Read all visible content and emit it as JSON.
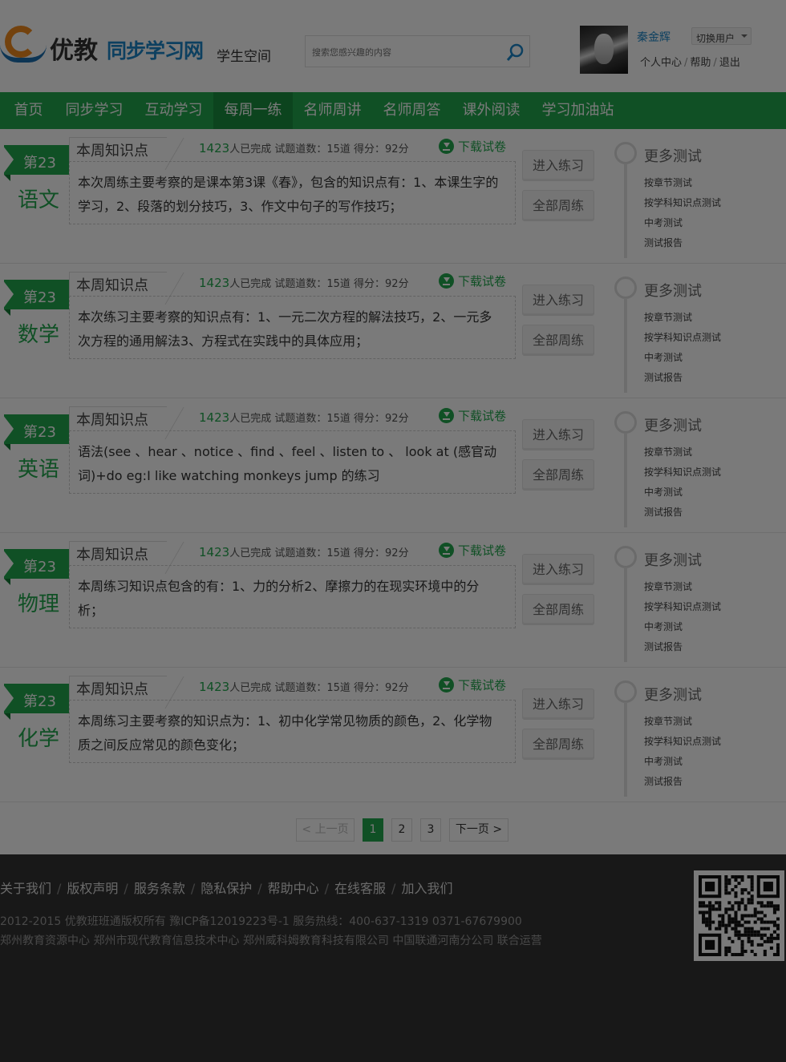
{
  "header": {
    "logo_text_1": "优教",
    "logo_text_2": "同步学习网",
    "space_label": "学生空间",
    "search_placeholder": "搜索您感兴趣的内容",
    "user_name": "秦金辉",
    "switch_user": "切换用户",
    "personal_center": "个人中心",
    "help": "帮助",
    "logout": "退出",
    "sep": "/"
  },
  "nav": {
    "items": [
      "首页",
      "同步学习",
      "互动学习",
      "每周一练",
      "名师周讲",
      "名师周答",
      "课外阅读",
      "学习加油站"
    ],
    "active": "每周一练"
  },
  "rows": [
    {
      "week": "第23",
      "subject": "语文",
      "tab_title": "本周知识点",
      "completed": "1423",
      "completed_suffix": "人已完成",
      "question_count": "试题道数：15道",
      "score": "得分：92分",
      "download": "下载试卷",
      "desc": "本次周练主要考察的是课本第3课《春》，包含的知识点有：1、本课生字的学习，2、段落的划分技巧，3、作文中句子的写作技巧；",
      "enter": "进入练习",
      "all": "全部周练",
      "more_title": "更多测试",
      "more_links": [
        "按章节测试",
        "按学科知识点测试",
        "中考测试",
        "测试报告"
      ]
    },
    {
      "week": "第23",
      "subject": "数学",
      "tab_title": "本周知识点",
      "completed": "1423",
      "completed_suffix": "人已完成",
      "question_count": "试题道数：15道",
      "score": "得分：92分",
      "download": "下载试卷",
      "desc": "本次练习主要考察的知识点有：1、一元二次方程的解法技巧，2、一元多次方程的通用解法3、方程式在实践中的具体应用；",
      "enter": "进入练习",
      "all": "全部周练",
      "more_title": "更多测试",
      "more_links": [
        "按章节测试",
        "按学科知识点测试",
        "中考测试",
        "测试报告"
      ]
    },
    {
      "week": "第23",
      "subject": "英语",
      "tab_title": "本周知识点",
      "completed": "1423",
      "completed_suffix": "人已完成",
      "question_count": "试题道数：15道",
      "score": "得分：92分",
      "download": "下载试卷",
      "desc": "语法(see 、hear 、notice 、find 、feel 、listen to 、 look at (感官动词)+do eg:I like watching monkeys jump 的练习",
      "enter": "进入练习",
      "all": "全部周练",
      "more_title": "更多测试",
      "more_links": [
        "按章节测试",
        "按学科知识点测试",
        "中考测试",
        "测试报告"
      ]
    },
    {
      "week": "第23",
      "subject": "物理",
      "tab_title": "本周知识点",
      "completed": "1423",
      "completed_suffix": "人已完成",
      "question_count": "试题道数：15道",
      "score": "得分：92分",
      "download": "下载试卷",
      "desc": "本周练习知识点包含的有：1、力的分析2、摩擦力的在现实环境中的分析；",
      "enter": "进入练习",
      "all": "全部周练",
      "more_title": "更多测试",
      "more_links": [
        "按章节测试",
        "按学科知识点测试",
        "中考测试",
        "测试报告"
      ]
    },
    {
      "week": "第23",
      "subject": "化学",
      "tab_title": "本周知识点",
      "completed": "1423",
      "completed_suffix": "人已完成",
      "question_count": "试题道数：15道",
      "score": "得分：92分",
      "download": "下载试卷",
      "desc": "本周练习主要考察的知识点为：1、初中化学常见物质的颜色，2、化学物质之间反应常见的颜色变化；",
      "enter": "进入练习",
      "all": "全部周练",
      "more_title": "更多测试",
      "more_links": [
        "按章节测试",
        "按学科知识点测试",
        "中考测试",
        "测试报告"
      ]
    }
  ],
  "pager": {
    "prev": "< 上一页",
    "pages": [
      "1",
      "2",
      "3"
    ],
    "current": "1",
    "next": "下一页 >"
  },
  "footer": {
    "links": [
      "关于我们",
      "版权声明",
      "服务条款",
      "隐私保护",
      "帮助中心",
      "在线客服",
      "加入我们"
    ],
    "sep": "/",
    "copyright": "2012-2015 优教班班通版权所有  豫ICP备12019223号-1      服务热线：400-637-1319   0371-67679900",
    "operators": "郑州教育资源中心    郑州市现代教育信息技术中心    郑州威科姆教育科技有限公司 中国联通河南分公司  联合运营"
  },
  "colors": {
    "brand_green": "#23a74e",
    "nav_active": "#1b8f40",
    "footer_bg": "#333333",
    "overlay": "rgba(0,0,0,0.52)"
  }
}
